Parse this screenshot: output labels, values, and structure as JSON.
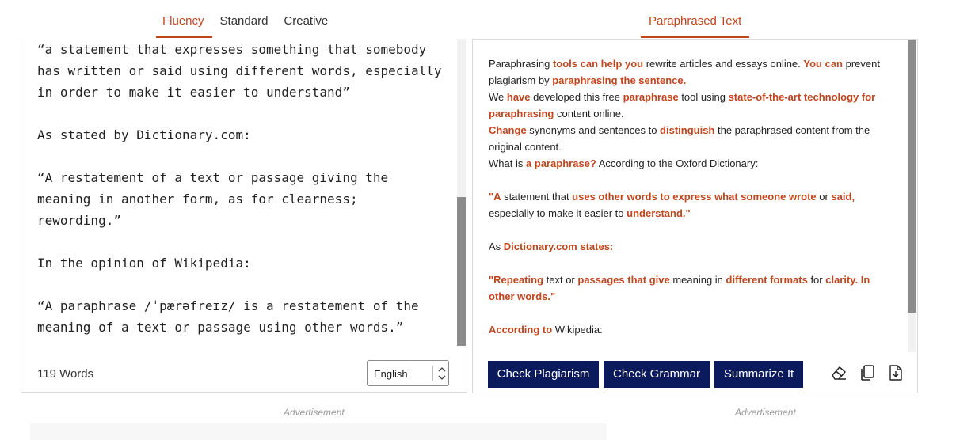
{
  "left_tabs": [
    "Fluency",
    "Standard",
    "Creative"
  ],
  "right_tabs": [
    "Paraphrased Text"
  ],
  "input": {
    "text": "“a statement that expresses something that somebody has written or said using different words, especially in order to make it easier to understand”\n\nAs stated by Dictionary.com:\n\n“A restatement of a text or passage giving the meaning in another form, as for clearness; rewording.”\n\nIn the opinion of Wikipedia:\n\n“A paraphrase /ˈpærəfreɪz/ is a restatement of the meaning of a text or passage using other words.”",
    "word_count": "119 Words",
    "language": "English"
  },
  "output": {
    "paragraphs": [
      [
        {
          "t": "Paraphrasing "
        },
        {
          "t": "tools can help you",
          "h": true
        },
        {
          "t": " rewrite articles and essays online. "
        },
        {
          "t": "You can",
          "h": true
        },
        {
          "t": " prevent plagiarism by "
        },
        {
          "t": "paraphrasing the sentence.",
          "h": true
        }
      ],
      [
        {
          "t": " We "
        },
        {
          "t": "have",
          "h": true
        },
        {
          "t": " developed this free "
        },
        {
          "t": "paraphrase",
          "h": true
        },
        {
          "t": " tool using "
        },
        {
          "t": "state-of-the-art technology for paraphrasing",
          "h": true
        },
        {
          "t": " content online."
        }
      ],
      [
        {
          "t": " "
        },
        {
          "t": "Change",
          "h": true
        },
        {
          "t": " synonyms and sentences to "
        },
        {
          "t": "distinguish",
          "h": true
        },
        {
          "t": " the paraphrased content  from the original content."
        }
      ],
      [
        {
          "t": "  What is "
        },
        {
          "t": "a paraphrase?",
          "h": true
        },
        {
          "t": " According to the Oxford Dictionary:"
        }
      ],
      [],
      [
        {
          "t": " "
        },
        {
          "t": "\"A",
          "h": true
        },
        {
          "t": " statement that "
        },
        {
          "t": "uses other words to express what someone wrote",
          "h": true
        },
        {
          "t": " or "
        },
        {
          "t": "said,",
          "h": true
        },
        {
          "t": " especially  to make it easier to "
        },
        {
          "t": "understand.\"",
          "h": true
        }
      ],
      [],
      [
        {
          "t": " As "
        },
        {
          "t": "Dictionary.com states:",
          "h": true
        }
      ],
      [],
      [
        {
          "t": " "
        },
        {
          "t": "\"Repeating",
          "h": true
        },
        {
          "t": " text or "
        },
        {
          "t": "passages that give",
          "h": true
        },
        {
          "t": " meaning in "
        },
        {
          "t": "different formats",
          "h": true
        },
        {
          "t": " for "
        },
        {
          "t": "clarity. In other words.\"",
          "h": true
        }
      ],
      [],
      [
        {
          "t": " "
        },
        {
          "t": "According to",
          "h": true
        },
        {
          "t": " Wikipedia:"
        }
      ]
    ]
  },
  "buttons": {
    "check_plagiarism": "Check Plagiarism",
    "check_grammar": "Check Grammar",
    "summarize": "Summarize It"
  },
  "icons": [
    "eraser-icon",
    "copy-icon",
    "download-icon"
  ],
  "ads": {
    "left": "Advertisement",
    "right": "Advertisement"
  },
  "colors": {
    "accent": "#c0461e",
    "button_bg": "#0a1a5c"
  }
}
